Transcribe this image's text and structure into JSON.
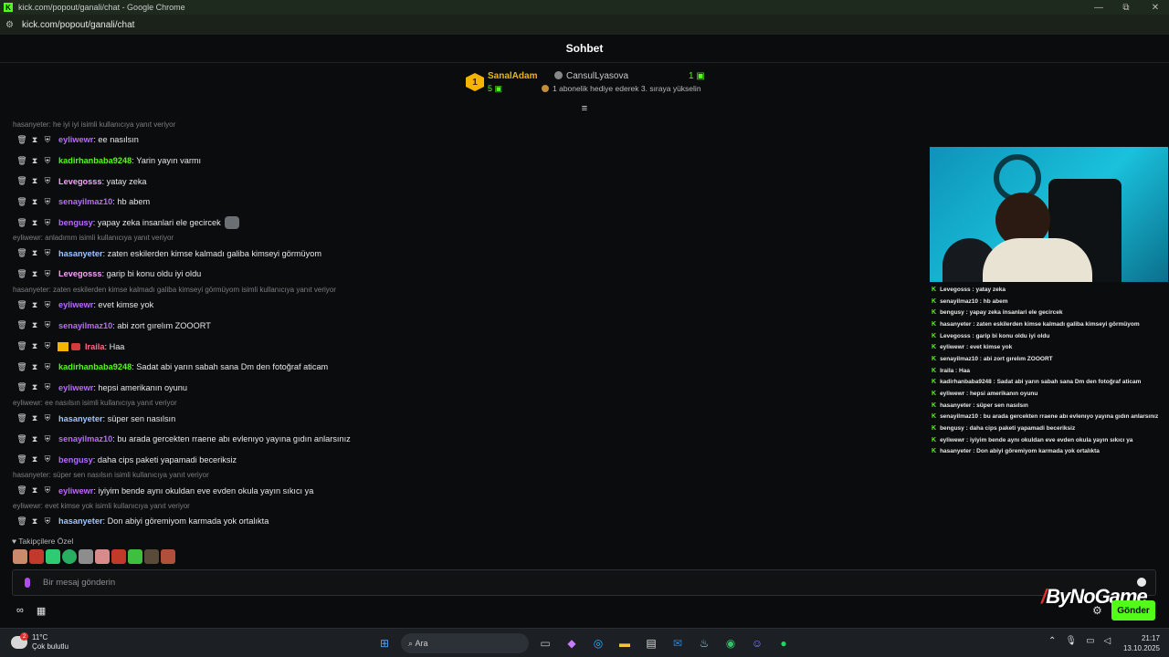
{
  "browser": {
    "window_title": "kick.com/popout/ganali/chat - Google Chrome",
    "url": "kick.com/popout/ganali/chat",
    "minimize": "—",
    "restore": "⧉",
    "close": "✕"
  },
  "chat": {
    "title": "Sohbet",
    "leaderboard": {
      "rank": "1",
      "top_name": "SanalAdam",
      "top_count": "5",
      "second_name": "CansulLyasova",
      "second_count": "1",
      "hint": "1 abonelik hediye ederek 3. sıraya yükselin"
    },
    "collapse_icon": "≡",
    "messages": [
      {
        "reply": "hasanyeter: he iyi iyi isimli kullanıcıya yanıt veriyor",
        "user": "eyliwewr",
        "color": "#b86bff",
        "text": "ee nasılsın"
      },
      {
        "reply": "",
        "user": "kadirhanbaba9248",
        "color": "#53fc18",
        "text": "Yarin yayın varmı"
      },
      {
        "reply": "",
        "user": "Levegosss",
        "color": "#f3a4f7",
        "text": "yatay zeka"
      },
      {
        "reply": "",
        "user": "senayilmaz10",
        "color": "#b86bff",
        "text": "hb abem"
      },
      {
        "reply": "",
        "user": "bengusy",
        "color": "#b86bff",
        "text": "yapay zeka insanlari ele gecircek",
        "emote": true
      },
      {
        "reply": "eyliwewr: anladımm isimli kullanıcıya yanıt veriyor",
        "user": "hasanyeter",
        "color": "#9ec6ff",
        "text": "zaten eskilerden kimse kalmadı galiba kimseyi görmüyom"
      },
      {
        "reply": "",
        "user": "Levegosss",
        "color": "#f3a4f7",
        "text": "garip bi konu oldu iyi oldu"
      },
      {
        "reply": "hasanyeter: zaten eskilerden kimse kalmadı galiba kimseyi görmüyom isimli kullanıcıya yanıt veriyor",
        "user": "eyliwewr",
        "color": "#b86bff",
        "text": "evet kimse yok"
      },
      {
        "reply": "",
        "user": "senayilmaz10",
        "color": "#b86bff",
        "text": "abi zort gırelım ZOOORT"
      },
      {
        "reply": "",
        "user": "Iraila",
        "color": "#ff6b8b",
        "text": "Haa",
        "crown": true
      },
      {
        "reply": "",
        "user": "kadirhanbaba9248",
        "color": "#53fc18",
        "text": "Sadat abi yarın sabah sana Dm den fotoğraf aticam"
      },
      {
        "reply": "",
        "user": "eyliwewr",
        "color": "#b86bff",
        "text": "hepsi amerikanın oyunu"
      },
      {
        "reply": "eyliwewr: ee nasılsın isimli kullanıcıya yanıt veriyor",
        "user": "hasanyeter",
        "color": "#9ec6ff",
        "text": "süper sen nasılsın"
      },
      {
        "reply": "",
        "user": "senayilmaz10",
        "color": "#b86bff",
        "text": "bu arada gercekten rraene abı evlenıyo yayına gıdın anlarsınız"
      },
      {
        "reply": "",
        "user": "bengusy",
        "color": "#b86bff",
        "text": "daha cips paketi yapamadi beceriksiz"
      },
      {
        "reply": "hasanyeter: süper sen nasılsın isimli kullanıcıya yanıt veriyor",
        "user": "eyliwewr",
        "color": "#b86bff",
        "text": "iyiyim bende aynı okuldan eve evden okula yayın sıkıcı ya"
      },
      {
        "reply": "eyliwewr: evet kimse yok isimli kullanıcıya yanıt veriyor",
        "user": "hasanyeter",
        "color": "#9ec6ff",
        "text": "Don abiyi göremiyom karmada yok ortalıkta"
      }
    ],
    "followers_label": "♥ Takipçilere Özel",
    "input_placeholder": "Bir mesaj gönderin",
    "send_label": "Gönder"
  },
  "overlay": {
    "brand": "ByNoGame",
    "lines": [
      {
        "user": "Levegosss",
        "text": "yatay zeka"
      },
      {
        "user": "senayilmaz10",
        "text": "hb abem"
      },
      {
        "user": "bengusy",
        "text": "yapay zeka insanlari ele gecircek"
      },
      {
        "user": "hasanyeter",
        "text": "zaten eskilerden kimse kalmadı galiba kimseyi görmüyom"
      },
      {
        "user": "Levegosss",
        "text": "garip bi konu oldu iyi oldu"
      },
      {
        "user": "eyliwewr",
        "text": "evet kimse yok"
      },
      {
        "user": "senayilmaz10",
        "text": "abi zort gırelım ZOOORT"
      },
      {
        "user": "Iraila",
        "text": "Haa"
      },
      {
        "user": "kadirhanbaba9248",
        "text": "Sadat abi yarın sabah sana Dm den fotoğraf aticam"
      },
      {
        "user": "eyliwewr",
        "text": "hepsi amerikanın oyunu"
      },
      {
        "user": "hasanyeter",
        "text": "süper sen nasılsın"
      },
      {
        "user": "senayilmaz10",
        "text": "bu arada gercekten rraene abı evlenıyo yayına gıdın anlarsınız"
      },
      {
        "user": "bengusy",
        "text": "daha cips paketi yapamadi beceriksiz"
      },
      {
        "user": "eyliwewr",
        "text": "iyiyim bende aynı okuldan eve evden okula yayın sıkıcı ya"
      },
      {
        "user": "hasanyeter",
        "text": "Don abiyi göremiyom karmada yok ortalıkta"
      }
    ]
  },
  "taskbar": {
    "temperature": "11°C",
    "weather": "Çok bulutlu",
    "weather_badge": "2",
    "search_placeholder": "Ara",
    "time": "21:17",
    "date": "13.10.2025"
  },
  "colors": {
    "accent": "#53fc18",
    "background": "#0b0c0d"
  }
}
